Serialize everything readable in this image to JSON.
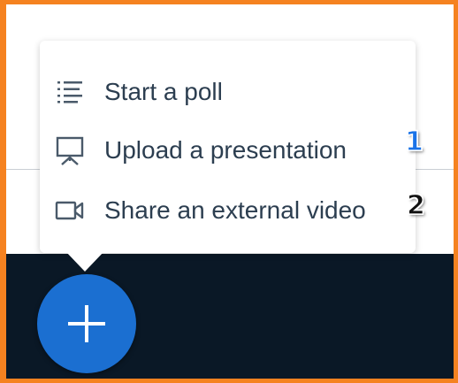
{
  "menu": {
    "items": [
      {
        "label": "Start a poll",
        "icon": "list-icon"
      },
      {
        "label": "Upload a presentation",
        "icon": "presentation-icon"
      },
      {
        "label": "Share an external video",
        "icon": "video-camera-icon"
      }
    ]
  },
  "annotations": {
    "badge_1": "1",
    "badge_2": "2"
  },
  "fab": {
    "icon": "plus-icon"
  },
  "colors": {
    "frame": "#f58220",
    "fab": "#1b6fd1",
    "dark_background": "#0a1826",
    "text": "#2c3e50",
    "badge_1": "#1a73e8"
  }
}
